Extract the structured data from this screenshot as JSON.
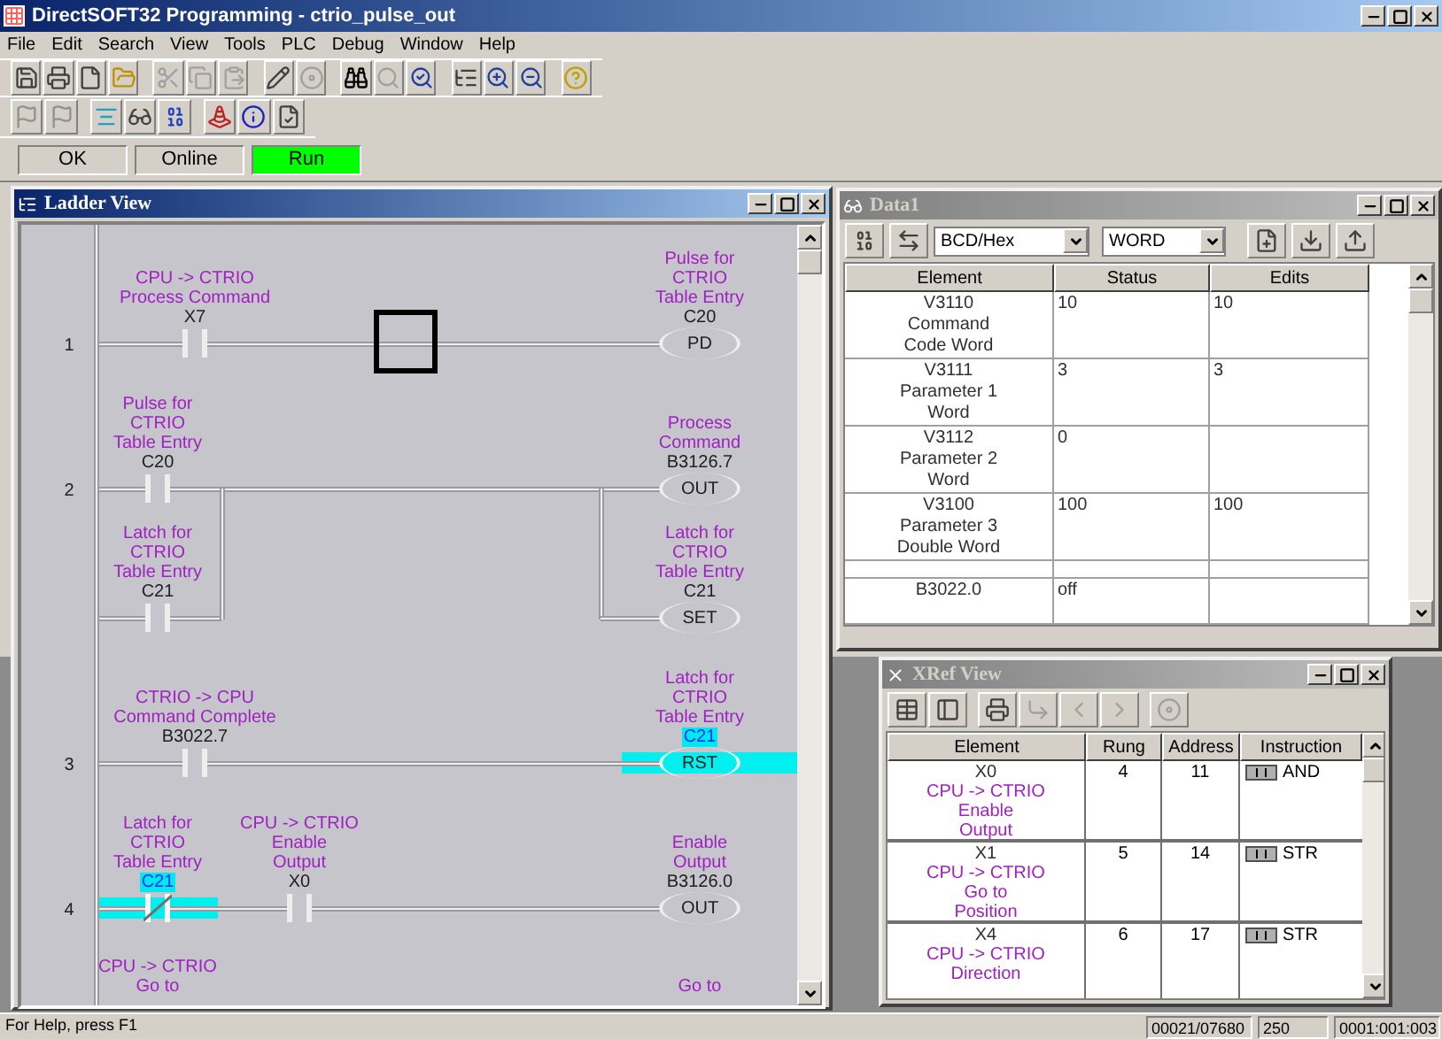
{
  "app": {
    "title": "DirectSOFT32 Programming - ctrio_pulse_out",
    "menu": [
      "File",
      "Edit",
      "Search",
      "View",
      "Tools",
      "PLC",
      "Debug",
      "Window",
      "Help"
    ]
  },
  "status_panels": [
    {
      "label": "OK",
      "lit": false
    },
    {
      "label": "Online",
      "lit": false
    },
    {
      "label": "Run",
      "lit": true
    }
  ],
  "ladder_view": {
    "title": "Ladder View",
    "rungs": [
      {
        "number": "1",
        "cursor": true,
        "rows": [
          {
            "contacts": [
              {
                "kind": "no",
                "selected": false,
                "description": [
                  "CPU -> CTRIO",
                  "Process Command"
                ],
                "address": "X7"
              }
            ],
            "coil": {
              "selected": false,
              "description": [
                "Pulse for",
                "CTRIO",
                "Table Entry"
              ],
              "address": "C20",
              "instruction": "PD"
            }
          }
        ]
      },
      {
        "number": "2",
        "cursor": false,
        "rows": [
          {
            "contacts": [
              {
                "kind": "no",
                "selected": false,
                "description": [
                  "Pulse for",
                  "CTRIO",
                  "Table Entry"
                ],
                "address": "C20"
              }
            ],
            "coil": {
              "selected": false,
              "description": [
                "Process",
                "Command"
              ],
              "address": "B3126.7",
              "instruction": "OUT"
            }
          },
          {
            "contacts": [
              {
                "kind": "no",
                "selected": false,
                "description": [
                  "Latch for",
                  "CTRIO",
                  "Table Entry"
                ],
                "address": "C21"
              }
            ],
            "coil": {
              "selected": false,
              "description": [
                "Latch for",
                "CTRIO",
                "Table Entry"
              ],
              "address": "C21",
              "instruction": "SET"
            }
          }
        ]
      },
      {
        "number": "3",
        "cursor": false,
        "rows": [
          {
            "contacts": [
              {
                "kind": "no",
                "selected": false,
                "description": [
                  "CTRIO -> CPU",
                  "Command Complete"
                ],
                "address": "B3022.7"
              }
            ],
            "coil": {
              "selected": true,
              "description": [
                "Latch for",
                "CTRIO",
                "Table Entry"
              ],
              "address": "C21",
              "instruction": "RST"
            }
          }
        ]
      },
      {
        "number": "4",
        "cursor": false,
        "rows": [
          {
            "contacts": [
              {
                "kind": "nc",
                "selected": true,
                "description": [
                  "Latch for",
                  "CTRIO",
                  "Table Entry"
                ],
                "address": "C21"
              },
              {
                "kind": "no",
                "selected": false,
                "description": [
                  "CPU -> CTRIO",
                  "Enable",
                  "Output"
                ],
                "address": "X0"
              }
            ],
            "coil": {
              "selected": false,
              "description": [
                "Enable",
                "Output"
              ],
              "address": "B3126.0",
              "instruction": "OUT"
            }
          }
        ]
      }
    ],
    "partial_rung": {
      "contact_description": [
        "CPU -> CTRIO",
        "Go to"
      ],
      "coil_description": [
        "Go to"
      ]
    }
  },
  "data_view": {
    "title": "Data1",
    "format": "BCD/Hex",
    "size": "WORD",
    "columns": [
      "Element",
      "Status",
      "Edits"
    ],
    "rows": [
      {
        "kind": "entry",
        "element": [
          "V3110",
          "Command",
          "Code Word"
        ],
        "status": "10",
        "edits": "10"
      },
      {
        "kind": "entry",
        "element": [
          "V3111",
          "Parameter 1",
          "Word"
        ],
        "status": "3",
        "edits": "3"
      },
      {
        "kind": "entry",
        "element": [
          "V3112",
          "Parameter 2",
          "Word"
        ],
        "status": "0"
      },
      {
        "kind": "entry",
        "element": [
          "V3100",
          "Parameter 3",
          "Double Word"
        ],
        "status": "100",
        "edits": "100"
      },
      {
        "kind": "blank"
      },
      {
        "kind": "entry",
        "element": [
          "B3022.0"
        ],
        "status": "off"
      }
    ]
  },
  "xref_view": {
    "title": "XRef View",
    "columns": [
      "Element",
      "Rung",
      "Address",
      "Instruction"
    ],
    "rows": [
      {
        "element": "X0",
        "description": [
          "CPU -> CTRIO",
          "Enable",
          "Output"
        ],
        "rung": "4",
        "address": "11",
        "instruction": "AND"
      },
      {
        "element": "X1",
        "description": [
          "CPU -> CTRIO",
          "Go to",
          "Position"
        ],
        "rung": "5",
        "address": "14",
        "instruction": "STR"
      },
      {
        "element": "X4",
        "description": [
          "CPU -> CTRIO",
          "Direction"
        ],
        "rung": "6",
        "address": "17",
        "instruction": "STR"
      }
    ]
  },
  "status_bar": {
    "help": "For Help, press F1",
    "fields": [
      "00021/07680",
      "250",
      "0001:001:003"
    ]
  }
}
